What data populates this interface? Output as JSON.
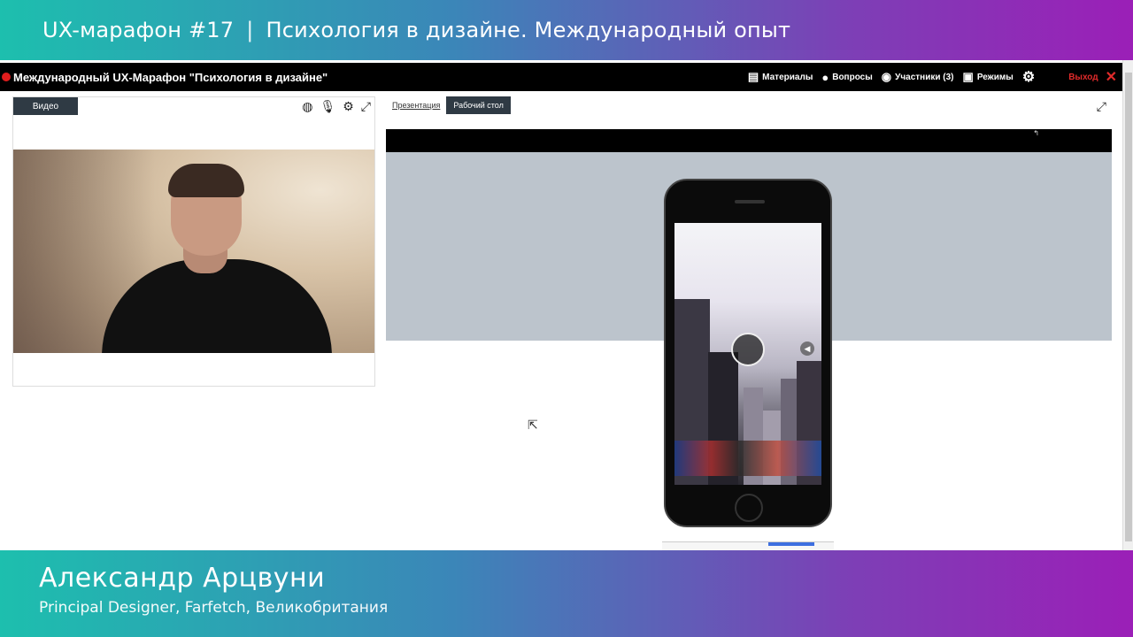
{
  "banner_top": {
    "event": "UX-марафон #17",
    "separator": "|",
    "topic": "Психология в дизайне. Международный опыт"
  },
  "app": {
    "title": "Международный UX-Марафон \"Психология в дизайне\"",
    "menu": {
      "materials": "Материалы",
      "questions": "Вопросы",
      "participants": "Участники (3)",
      "modes": "Режимы",
      "exit": "Выход"
    },
    "video_panel": {
      "tab": "Видео"
    },
    "presentation_panel": {
      "tabs": [
        "Презентация",
        "Рабочий стол"
      ],
      "active_tab": "Рабочий стол"
    }
  },
  "speaker": {
    "name": "Александр Арцвуни",
    "role": "Principal Designer, Farfetch, Великобритания"
  },
  "icons": {
    "record": "record-dot-icon",
    "materials": "document-icon",
    "questions": "chat-icon",
    "participants": "eye-icon",
    "modes": "layout-icon",
    "settings": "gear-icon",
    "close": "close-icon",
    "webcam": "webcam-icon",
    "mic": "microphone-icon",
    "expand": "expand-icon",
    "cursor": "mouse-cursor-icon"
  },
  "colors": {
    "banner_start": "#1dbfae",
    "banner_end": "#9b1fb7",
    "app_header": "#000000",
    "active_tab": "#2f3a44",
    "exit": "#e02a2a"
  }
}
